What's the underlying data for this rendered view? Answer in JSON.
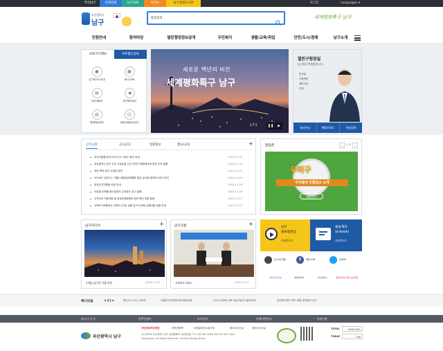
{
  "topbar": {
    "tabs": [
      {
        "label": "부산남구",
        "color": "#2b2e35"
      },
      {
        "label": "문화관광",
        "color": "#2e7cd6"
      },
      {
        "label": "남구의회",
        "color": "#2aa88b"
      },
      {
        "label": "보건소",
        "color": "#f08a24"
      },
      {
        "label": "남구종합도서관",
        "color": "#f5c519"
      }
    ],
    "login": "로그인",
    "languages": "Languages ▾"
  },
  "header": {
    "logo_small": "부산광역시",
    "logo_main": "남구",
    "search_value": "통합검색",
    "slogan": "세계평화특구 남구"
  },
  "gnb": [
    "민원안내",
    "참여마당",
    "열린행정정보공개",
    "주민복지",
    "생활/교육/취업",
    "안전/도시/경제",
    "남구소개"
  ],
  "quick": {
    "tab1": "바로가기메뉴",
    "tab2": "자주찾는정보",
    "items": [
      "남구청게시안내",
      "행사/교육",
      "지방세정보",
      "국민제보센터",
      "평생학습센터",
      "대중교통환승센터"
    ]
  },
  "main_visual": {
    "line1": "새로운 백년의 비전",
    "line2": "세계평화특구 남구",
    "page": "1 / 3"
  },
  "mayor": {
    "title": "열린구청장실",
    "subtitle": "남구청장 박재범입니다.",
    "menu": [
      "인사말",
      "구정목표",
      "재미노트",
      "관계"
    ],
    "buttons": [
      "청사안내",
      "행정조직도",
      "직원검색"
    ]
  },
  "notice": {
    "tabs": [
      "공지사항",
      "고시공고",
      "입찰정보",
      "행사/교육"
    ],
    "items": [
      {
        "title": "부산소통합(부산소식시선) 서비스 중단 안내",
        "date": "2018-11-30"
      },
      {
        "title": "부산광역시 남구 주민 고급오일 신규 인력기 행정매크게 운영 규칙 발행",
        "date": "2018-11-30"
      },
      {
        "title": "여권 책자 제거 사업장 공개",
        "date": "2018-11-29"
      },
      {
        "title": "2018년 1분기(1~3월) 대중공공위원회 점검 실시현 결과보고(안) 안내",
        "date": "2018-11-29"
      },
      {
        "title": "운영선거지원팀 모집 안내",
        "date": "2018-11-28"
      },
      {
        "title": "도로명 간판물 음식업권자 주차료도 공고 발행",
        "date": "2018-11-28"
      },
      {
        "title": "주차요지 지원규동 및 공공요원회재의 정보 확인 방법 알림",
        "date": "2018-11-27"
      },
      {
        "title": "주택도시보증공사 주택도시기금 상품 및 도시재생 금융지원 상품 안내",
        "date": "2018-11-21"
      }
    ]
  },
  "album": {
    "title": "알림존",
    "pager": "1 / 8",
    "banner_line1": "우리구",
    "banner_line2": "우리동네 인증업소 소개",
    "banner_btn": "바로가기"
  },
  "media": {
    "title": "남구미디어",
    "caption": "[가을] 남구의 가을 야경",
    "date": "2018-11-29"
  },
  "news": {
    "title": "남구신문",
    "caption": "고하되오 부BIC",
    "date": "2018-11-27"
  },
  "promo": {
    "video_title": "남구\n홍보동영상",
    "video_link": "자세히보기",
    "book_title": "홍보책자\n(e-book)",
    "book_link": "자세히보기"
  },
  "sns": [
    "인스타그램",
    "페이스북",
    "트위터"
  ],
  "partners": [
    "국회 한국의원",
    "행정자치부",
    "부산광역시",
    "행정안전부 정부 보안포털"
  ],
  "bannerzone": {
    "label": "배너모음",
    "items": [
      "확인도시 UCC 공모전",
      "겨울철 자연재난대비 행동요령",
      "2018 지방세 교육 상설 체납지 홍보안내",
      "유치원가연차 제도 위원 공직윤리 신고"
    ]
  },
  "footer_links": {
    "row1": [
      "부산시·구·군",
      "동주민센터",
      "부서안내",
      "관계기관안내",
      "유관기관"
    ],
    "row2": [
      "개인정보처리방침",
      "저작권정책",
      "이메일무단수집거부",
      "찾아오시는길",
      "찾아오시는길"
    ]
  },
  "footer": {
    "logo": "부산광역시 남구",
    "address": "(우)48452 부산광역시 남구 유엔평화로 16(대연동)   TEL 051-607-4000   FAX 051-607-4444",
    "copyright": "Copyright(c) All Rights Reserved. 2018 by Namgu Busan",
    "total_label": "TOTAL",
    "total_value": "6,942,421",
    "today_label": "TODAY",
    "today_value": "338"
  },
  "colors": {
    "navy": "#1f5aa6",
    "dark": "#2b2e35",
    "accent": "#2e7cd6",
    "green": "#70a83c"
  }
}
